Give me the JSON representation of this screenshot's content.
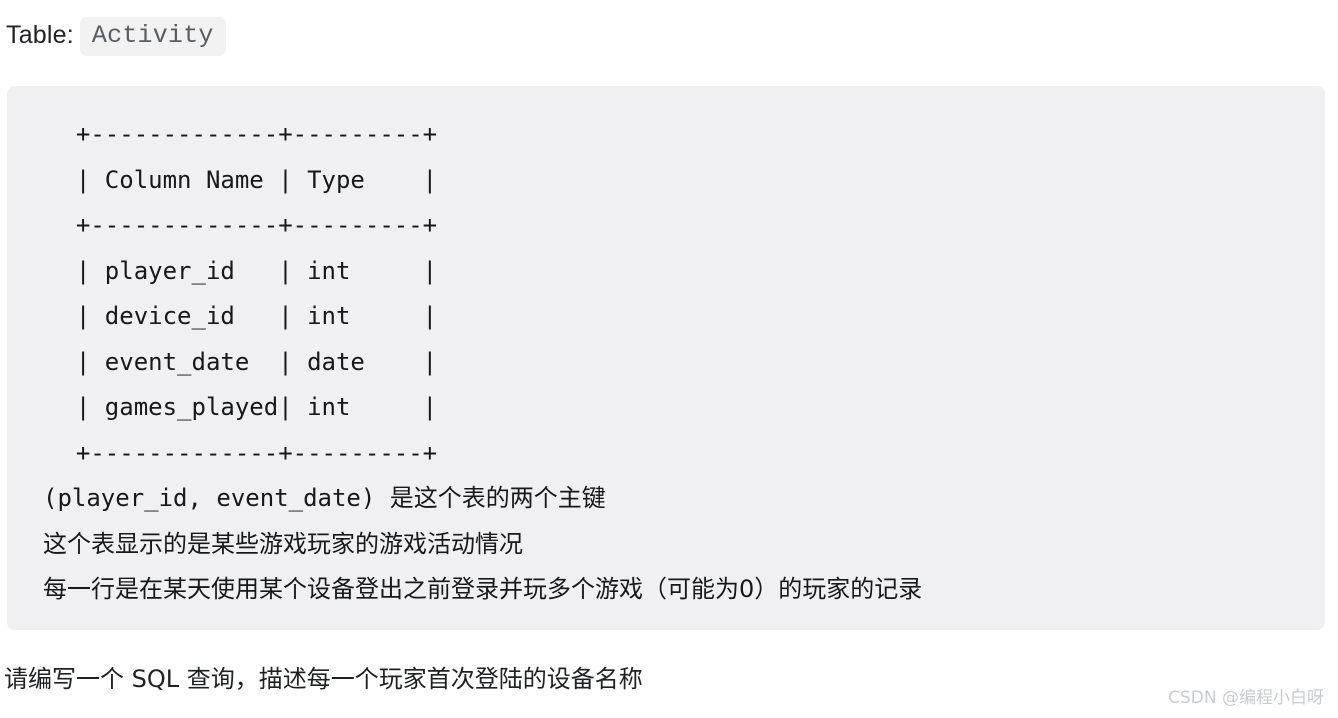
{
  "heading": {
    "label": "Table:",
    "table_name": "Activity"
  },
  "code_block": {
    "background_color": "#f0f0f2",
    "ascii_table": "  +-------------+---------+\n  | Column Name | Type    |\n  +-------------+---------+\n  | player_id   | int     |\n  | device_id   | int     |\n  | event_date  | date    |\n  | games_played| int     |\n  +-------------+---------+",
    "lines": [
      "  +-------------+---------+",
      "  | Column Name | Type    |",
      "  +-------------+---------+",
      "  | player_id   | int     |",
      "  | device_id   | int     |",
      "  | event_date  | date    |",
      "  | games_played| int     |",
      "  +-------------+---------+"
    ],
    "table": {
      "columns": [
        "Column Name",
        "Type"
      ],
      "rows": [
        [
          "player_id",
          "int"
        ],
        [
          "device_id",
          "int"
        ],
        [
          "event_date",
          "date"
        ],
        [
          "games_played",
          "int"
        ]
      ]
    },
    "notes": {
      "primary_key": "(player_id, event_date) 是这个表的两个主键",
      "description": "这个表显示的是某些游戏玩家的游戏活动情况",
      "row_meaning": "每一行是在某天使用某个设备登出之前登录并玩多个游戏（可能为0）的玩家的记录"
    }
  },
  "question": "请编写一个 SQL 查询，描述每一个玩家首次登陆的设备名称",
  "watermark": "CSDN @编程小白呀"
}
